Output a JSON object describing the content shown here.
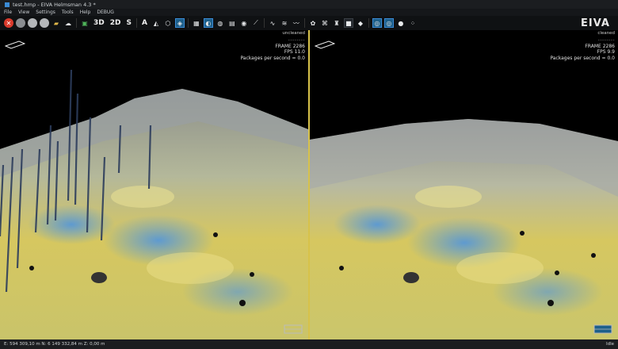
{
  "window": {
    "title": "test.hmp - EIVA Helmsman 4.3 *"
  },
  "menu": {
    "items": [
      "File",
      "View",
      "Settings",
      "Tools",
      "Help",
      "DEBUG"
    ]
  },
  "toolbar": {
    "btn_3d": "3D",
    "btn_2d": "2D",
    "btn_s": "S",
    "btn_a": "A"
  },
  "brand": {
    "logo_text": "EIVA"
  },
  "views": {
    "left": {
      "label": "uncleaned",
      "frame": "FRAME 2286",
      "fps": "FPS 11.0",
      "packets": "Packages per second = 0.0"
    },
    "right": {
      "label": "cleaned",
      "frame": "FRAME 2286",
      "fps": "FPS 9.9",
      "packets": "Packages per second = 0.0"
    }
  },
  "status": {
    "coords": "E: 594 309,10 m  N: 6 149 332,84 m  Z: 0,00 m",
    "mode": "Idle"
  },
  "colors": {
    "seabed_yellow": "#d8c85a",
    "seabed_blue": "#6fa8d6",
    "accent_divider": "#d7c24a"
  }
}
